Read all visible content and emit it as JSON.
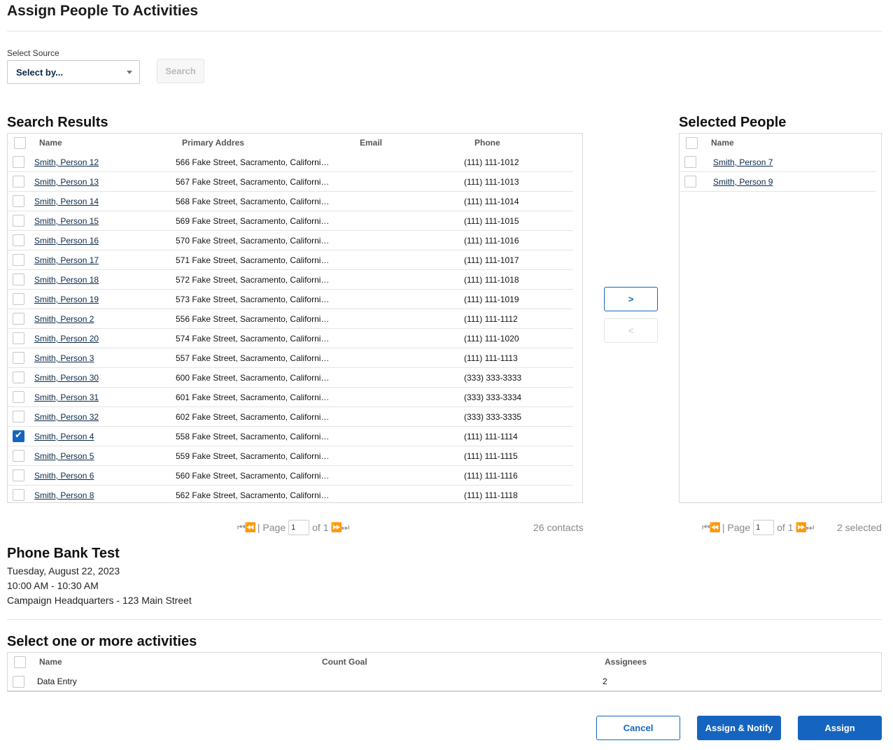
{
  "page": {
    "title": "Assign People To Activities"
  },
  "source": {
    "label": "Select Source",
    "selected": "Select by...",
    "search_label": "Search"
  },
  "results": {
    "title": "Search Results",
    "headers": {
      "name": "Name",
      "address": "Primary Addres",
      "email": "Email",
      "phone": "Phone"
    },
    "rows": [
      {
        "name": "Smith, Person 12",
        "address": "566 Fake Street, Sacramento, Californi…",
        "email": "",
        "phone": "(111) 111-1012",
        "checked": false
      },
      {
        "name": "Smith, Person 13",
        "address": "567 Fake Street, Sacramento, Californi…",
        "email": "",
        "phone": "(111) 111-1013",
        "checked": false
      },
      {
        "name": "Smith, Person 14",
        "address": "568 Fake Street, Sacramento, Californi…",
        "email": "",
        "phone": "(111) 111-1014",
        "checked": false
      },
      {
        "name": "Smith, Person 15",
        "address": "569 Fake Street, Sacramento, Californi…",
        "email": "",
        "phone": "(111) 111-1015",
        "checked": false
      },
      {
        "name": "Smith, Person 16",
        "address": "570 Fake Street, Sacramento, Californi…",
        "email": "",
        "phone": "(111) 111-1016",
        "checked": false
      },
      {
        "name": "Smith, Person 17",
        "address": "571 Fake Street, Sacramento, Californi…",
        "email": "",
        "phone": "(111) 111-1017",
        "checked": false
      },
      {
        "name": "Smith, Person 18",
        "address": "572 Fake Street, Sacramento, Californi…",
        "email": "",
        "phone": "(111) 111-1018",
        "checked": false
      },
      {
        "name": "Smith, Person 19",
        "address": "573 Fake Street, Sacramento, Californi…",
        "email": "",
        "phone": "(111) 111-1019",
        "checked": false
      },
      {
        "name": "Smith, Person 2",
        "address": "556 Fake Street, Sacramento, Californi…",
        "email": "",
        "phone": "(111) 111-1112",
        "checked": false
      },
      {
        "name": "Smith, Person 20",
        "address": "574 Fake Street, Sacramento, Californi…",
        "email": "",
        "phone": "(111) 111-1020",
        "checked": false
      },
      {
        "name": "Smith, Person 3",
        "address": "557 Fake Street, Sacramento, Californi…",
        "email": "",
        "phone": "(111) 111-1113",
        "checked": false
      },
      {
        "name": "Smith, Person 30",
        "address": "600 Fake Street, Sacramento, Californi…",
        "email": "",
        "phone": "(333) 333-3333",
        "checked": false
      },
      {
        "name": "Smith, Person 31",
        "address": "601 Fake Street, Sacramento, Californi…",
        "email": "",
        "phone": "(333) 333-3334",
        "checked": false
      },
      {
        "name": "Smith, Person 32",
        "address": "602 Fake Street, Sacramento, Californi…",
        "email": "",
        "phone": "(333) 333-3335",
        "checked": false
      },
      {
        "name": "Smith, Person 4",
        "address": "558 Fake Street, Sacramento, Californi…",
        "email": "",
        "phone": "(111) 111-1114",
        "checked": true
      },
      {
        "name": "Smith, Person 5",
        "address": "559 Fake Street, Sacramento, Californi…",
        "email": "",
        "phone": "(111) 111-1115",
        "checked": false
      },
      {
        "name": "Smith, Person 6",
        "address": "560 Fake Street, Sacramento, Californi…",
        "email": "",
        "phone": "(111) 111-1116",
        "checked": false
      },
      {
        "name": "Smith, Person 8",
        "address": "562 Fake Street, Sacramento, Californi…",
        "email": "",
        "phone": "(111) 111-1118",
        "checked": false
      }
    ],
    "pager": {
      "page_label": "| Page",
      "page_value": "1",
      "of_label": "of 1"
    },
    "count": "26 contacts"
  },
  "transfer": {
    "add_label": ">",
    "remove_label": "<"
  },
  "selected": {
    "title": "Selected People",
    "header_name": "Name",
    "rows": [
      {
        "name": "Smith, Person 7"
      },
      {
        "name": "Smith, Person 9"
      }
    ],
    "pager": {
      "page_label": "| Page",
      "page_value": "1",
      "of_label": "of 1"
    },
    "count": "2 selected"
  },
  "event": {
    "title": "Phone Bank Test",
    "date": "Tuesday, August 22, 2023",
    "time": "10:00 AM - 10:30 AM",
    "location": "Campaign Headquarters - 123 Main Street"
  },
  "activities": {
    "title": "Select one or more activities",
    "headers": {
      "name": "Name",
      "count_goal": "Count Goal",
      "assignees": "Assignees"
    },
    "rows": [
      {
        "name": "Data Entry",
        "count_goal": "",
        "assignees": "2"
      }
    ]
  },
  "actions": {
    "cancel": "Cancel",
    "assign_notify": "Assign & Notify",
    "assign": "Assign"
  },
  "colors": {
    "accent": "#1565c0",
    "link": "#0b2a4a"
  },
  "icons": {
    "first_page": "first-page-icon",
    "prev_page": "prev-page-icon",
    "next_page": "next-page-icon",
    "last_page": "last-page-icon",
    "dropdown": "chevron-down-icon"
  }
}
